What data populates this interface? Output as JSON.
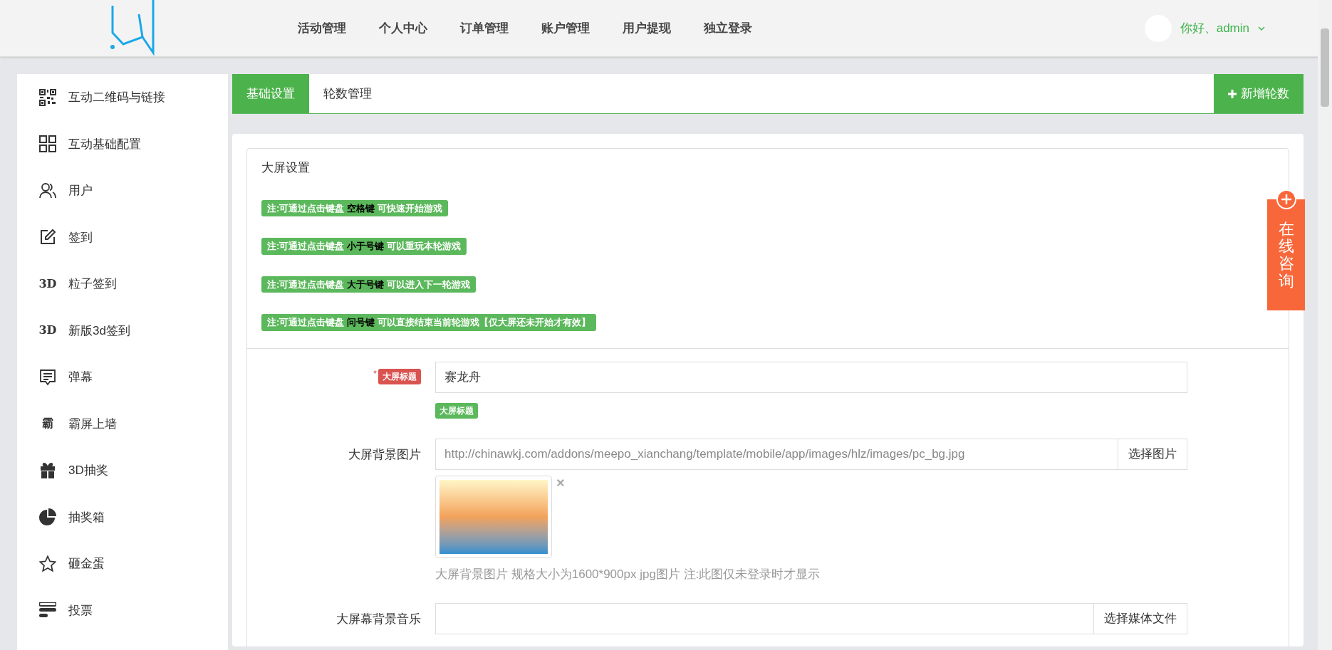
{
  "header": {
    "nav": [
      {
        "label": "活动管理"
      },
      {
        "label": "个人中心"
      },
      {
        "label": "订单管理"
      },
      {
        "label": "账户管理"
      },
      {
        "label": "用户提现"
      },
      {
        "label": "独立登录"
      }
    ],
    "user": "你好、admin"
  },
  "sidebar": {
    "items": [
      {
        "label": "互动二维码与链接",
        "kind": "qr"
      },
      {
        "label": "互动基础配置",
        "kind": "grid"
      },
      {
        "label": "用户",
        "kind": "users"
      },
      {
        "label": "签到",
        "kind": "edit"
      },
      {
        "label": "粒子签到",
        "kind": "glyph",
        "glyph": "3D"
      },
      {
        "label": "新版3d签到",
        "kind": "glyph",
        "glyph": "3D"
      },
      {
        "label": "弹幕",
        "kind": "message"
      },
      {
        "label": "霸屏上墙",
        "kind": "glyph",
        "glyph": "霸"
      },
      {
        "label": "3D抽奖",
        "kind": "gift"
      },
      {
        "label": "抽奖箱",
        "kind": "pie"
      },
      {
        "label": "砸金蛋",
        "kind": "star"
      },
      {
        "label": "投票",
        "kind": "bars"
      }
    ]
  },
  "tabs": [
    {
      "label": "基础设置",
      "selected": true
    },
    {
      "label": "轮数管理",
      "selected": false
    }
  ],
  "add_button": "新增轮数",
  "panel": {
    "title": "大屏设置",
    "notes": [
      {
        "prefix": "注:可通过点击键盘",
        "key": "空格键",
        "suffix": "可快速开始游戏"
      },
      {
        "prefix": "注:可通过点击键盘",
        "key": "小于号键",
        "suffix": "可以重玩本轮游戏"
      },
      {
        "prefix": "注:可通过点击键盘",
        "key": "大于号键",
        "suffix": "可以进入下一轮游戏"
      },
      {
        "prefix": "注:可通过点击键盘",
        "key": "问号键",
        "suffix": "可以直接结束当前轮游戏【仅大屏还未开始才有效】"
      }
    ],
    "fields": [
      {
        "kind": "text",
        "required": true,
        "required_mark": "*",
        "label": "大屏标题",
        "value": "赛龙舟",
        "hint_badge": "大屏标题"
      },
      {
        "kind": "image",
        "label": "大屏背景图片",
        "value": "http://chinawkj.com/addons/meepo_xianchang/template/mobile/app/images/hlz/images/pc_bg.jpg",
        "button": "选择图片",
        "remove": "×",
        "help": "大屏背景图片 规格大小为1600*900px jpg图片 注:此图仅未登录时才显示"
      },
      {
        "kind": "media",
        "label": "大屏幕背景音乐",
        "button": "选择媒体文件"
      }
    ]
  },
  "consult": {
    "label": "在线咨询"
  }
}
